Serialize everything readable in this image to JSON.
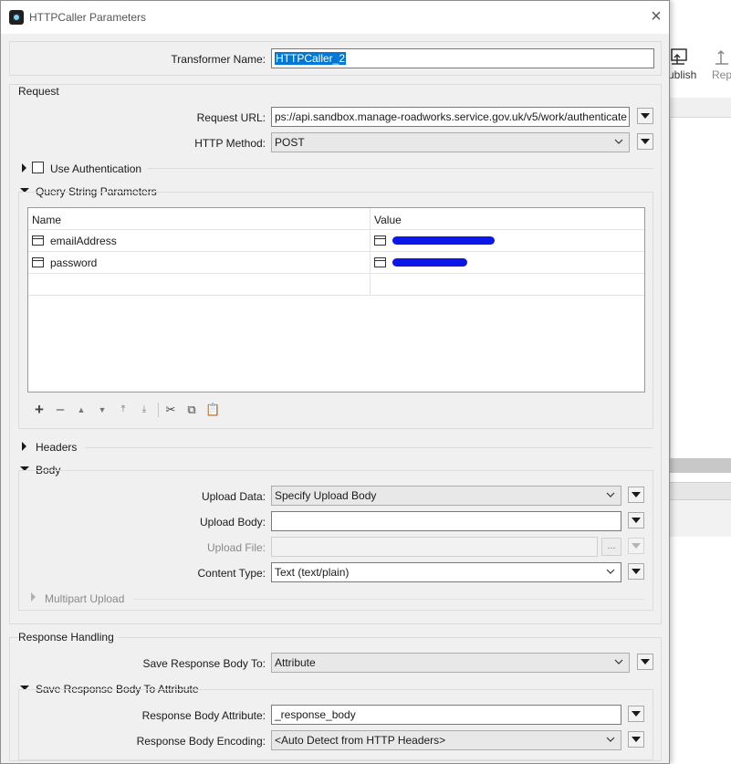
{
  "window": {
    "title": "HTTPCaller Parameters",
    "close": "×"
  },
  "transformer": {
    "label": "Transformer Name:",
    "value": "HTTPCaller_2"
  },
  "request": {
    "group_title": "Request",
    "url_label": "Request URL:",
    "url_value": "ps://api.sandbox.manage-roadworks.service.gov.uk/v5/work/authenticate",
    "method_label": "HTTP Method:",
    "method_value": "POST",
    "use_auth_label": "Use Authentication",
    "use_auth_checked": false,
    "query_params": {
      "title": "Query String Parameters",
      "columns": [
        "Name",
        "Value"
      ],
      "rows": [
        {
          "name": "emailAddress",
          "value_redacted": true
        },
        {
          "name": "password",
          "value_redacted": true
        },
        {
          "name": "",
          "value_redacted": false
        }
      ]
    },
    "table_toolbar_icons": [
      "add-icon",
      "remove-icon",
      "move-up-icon",
      "move-down-icon",
      "move-top-icon",
      "move-bottom-icon",
      "cut-icon",
      "copy-icon",
      "paste-icon"
    ],
    "headers_label": "Headers",
    "body": {
      "title": "Body",
      "upload_data_label": "Upload Data:",
      "upload_data_value": "Specify Upload Body",
      "upload_body_label": "Upload Body:",
      "upload_body_value": "",
      "upload_file_label": "Upload File:",
      "upload_file_value": "",
      "browse_label": "...",
      "content_type_label": "Content Type:",
      "content_type_value": "Text (text/plain)",
      "multipart_label": "Multipart Upload"
    }
  },
  "response": {
    "group_title": "Response Handling",
    "save_to_label": "Save Response Body To:",
    "save_to_value": "Attribute",
    "attr_section_title": "Save Response Body To Attribute",
    "attr_label": "Response Body Attribute:",
    "attr_value": "_response_body",
    "encoding_label": "Response Body Encoding:",
    "encoding_value": "<Auto Detect from HTTP Headers>"
  },
  "background_app": {
    "toolbar": [
      {
        "label": "ublish",
        "icon": "publish-icon"
      },
      {
        "label": "Rep",
        "icon": "reproject-icon"
      }
    ]
  },
  "colors": {
    "selection": "#0078d7",
    "redaction": "#0b17e8",
    "dialog_bg": "#f0f0f0"
  }
}
